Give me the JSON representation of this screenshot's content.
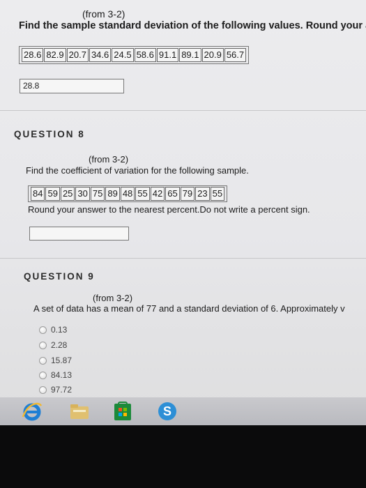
{
  "q7": {
    "subtitle": "(from 3-2)",
    "prompt": "Find the sample standard deviation of the following values. Round your ans",
    "values": [
      "28.6",
      "82.9",
      "20.7",
      "34.6",
      "24.5",
      "58.6",
      "91.1",
      "89.1",
      "20.9",
      "56.7"
    ],
    "answer": "28.8"
  },
  "q8": {
    "heading": "QUESTION 8",
    "subtitle": "(from 3-2)",
    "prompt": "Find the coefficient of variation for the following sample.",
    "values": [
      "84",
      "59",
      "25",
      "30",
      "75",
      "89",
      "48",
      "55",
      "42",
      "65",
      "79",
      "23",
      "55"
    ],
    "instruction": "Round your answer to the nearest percent.Do not write a percent sign.",
    "answer": ""
  },
  "q9": {
    "heading": "QUESTION 9",
    "subtitle": "(from 3-2)",
    "prompt": "A set of data has a mean of 77 and a standard deviation of 6. Approximately v",
    "options": [
      "0.13",
      "2.28",
      "15.87",
      "84.13",
      "97.72"
    ]
  },
  "taskbar": {
    "icons": [
      "ie-icon",
      "file-explorer-icon",
      "store-icon",
      "skype-icon"
    ]
  }
}
